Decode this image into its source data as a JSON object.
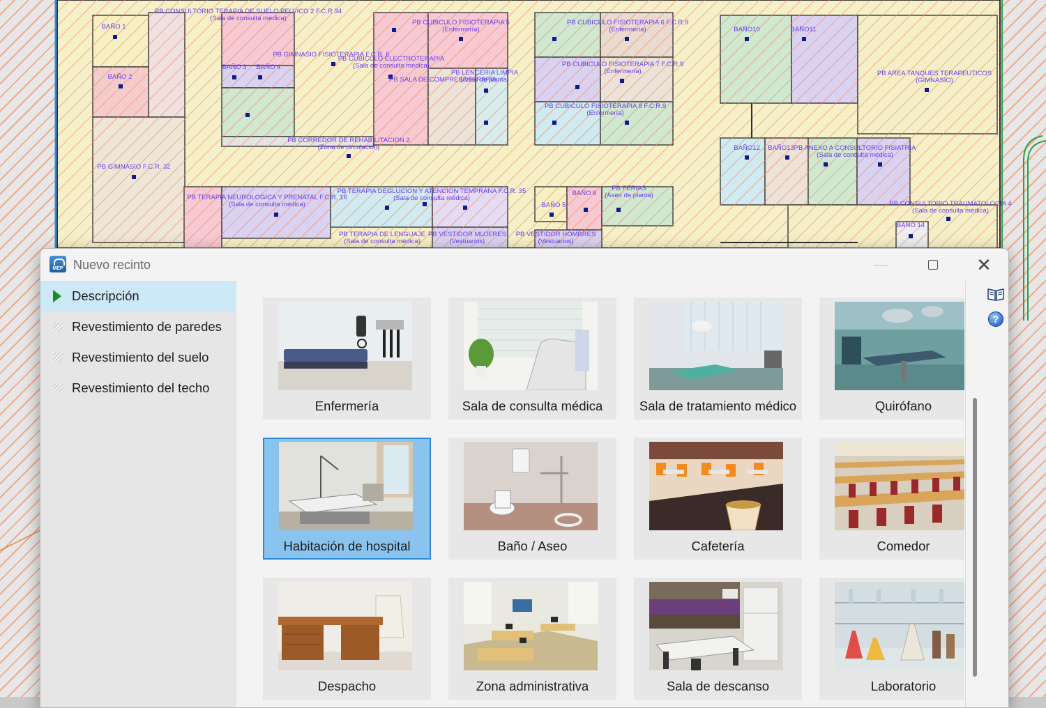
{
  "dialog": {
    "title": "Nuevo recinto",
    "app_icon_text": "MEP",
    "icons": {
      "app": "mep-app-icon",
      "minimize": "minimize-icon",
      "maximize": "maximize-icon",
      "close": "close-icon",
      "book": "book-icon",
      "help": "help-icon"
    }
  },
  "nav": {
    "items": [
      {
        "label": "Descripción",
        "active": true
      },
      {
        "label": "Revestimiento de paredes",
        "active": false
      },
      {
        "label": "Revestimiento del suelo",
        "active": false
      },
      {
        "label": "Revestimiento del techo",
        "active": false
      }
    ]
  },
  "rooms": [
    {
      "label": "Enfermería",
      "selected": false
    },
    {
      "label": "Sala de consulta médica",
      "selected": false
    },
    {
      "label": "Sala de tratamiento médico",
      "selected": false
    },
    {
      "label": "Quirófano",
      "selected": false
    },
    {
      "label": "Habitación de hospital",
      "selected": true
    },
    {
      "label": "Baño / Aseo",
      "selected": false
    },
    {
      "label": "Cafetería",
      "selected": false
    },
    {
      "label": "Comedor",
      "selected": false
    },
    {
      "label": "Despacho",
      "selected": false
    },
    {
      "label": "Zona administrativa",
      "selected": false
    },
    {
      "label": "Sala de descanso",
      "selected": false
    },
    {
      "label": "Laboratorio",
      "selected": false
    }
  ],
  "cad": {
    "labels": [
      {
        "name": "PB CONSULTORIO TERAPIA DE SUELO PELVICO 2 F.C.R 34",
        "sub": "(Sala de consulta médica)"
      },
      {
        "name": "BAÑO 1",
        "sub": ""
      },
      {
        "name": "BAÑO 2",
        "sub": ""
      },
      {
        "name": "PB GIMNASIO F.C.R. 32",
        "sub": ""
      },
      {
        "name": "PB GIMNASIO FISIOTERAPIA F.C.R. 6",
        "sub": ""
      },
      {
        "name": "BAÑO 3",
        "sub": ""
      },
      {
        "name": "BAÑO 4",
        "sub": ""
      },
      {
        "name": "PB CUBICULO ELECTROTERAPIA",
        "sub": "(Sala de consulta médica)"
      },
      {
        "name": "PB SALA DE COMPRESOTERAPIA",
        "sub": ""
      },
      {
        "name": "PB CORREDOR DE REHABILITACION 2",
        "sub": "(Zona de circulación)"
      },
      {
        "name": "PB LENCERIA LIMPIA",
        "sub": "(Aseo de planta)"
      },
      {
        "name": "PB CUBICULO FISIOTERAPIA 5",
        "sub": "(Enfermería)"
      },
      {
        "name": "PB CUBICULO FISIOTERAPIA 6 F.C.R.9",
        "sub": "(Enfermería)"
      },
      {
        "name": "PB CUBICULO FISIOTERAPIA 7 F.C.R.9",
        "sub": "(Enfermería)"
      },
      {
        "name": "PB CUBICULO FISIOTERAPIA 8 F.C.R.9",
        "sub": "(Enfermería)"
      },
      {
        "name": "BAÑO10",
        "sub": ""
      },
      {
        "name": "BAÑO11",
        "sub": ""
      },
      {
        "name": "PB AREA TANQUES TERAPEUTICOS",
        "sub": "(GIMNASIO)"
      },
      {
        "name": "BAÑO12",
        "sub": ""
      },
      {
        "name": "BAÑO13",
        "sub": ""
      },
      {
        "name": "PB ANEXO A CONSULTORIO FISIATRIA",
        "sub": "(Sala de consulta médica)"
      },
      {
        "name": "PB TERAPIA NEUROLOGICA Y PRENATAL F.C.R. 16",
        "sub": "(Sala de consulta médica)"
      },
      {
        "name": "PB TERAPIA DEGLUCION Y ATENCION TEMPRANA F.C.R. 35",
        "sub": "(Sala de consulta médica)"
      },
      {
        "name": "BAÑO 5",
        "sub": ""
      },
      {
        "name": "BAÑO 6",
        "sub": ""
      },
      {
        "name": "PB FERIAS",
        "sub": "(Aseo de planta)"
      },
      {
        "name": "PB TERAPIA DE LENGUAJE",
        "sub": "(Sala de consulta médica)"
      },
      {
        "name": "PB VESTIDOR MUJERES",
        "sub": "(Vestuarios)"
      },
      {
        "name": "PB VESTIDOR HOMBRES",
        "sub": "(Vestuarios)"
      },
      {
        "name": "PB CONSULTORIO TRAUMATOLOGIA 4",
        "sub": "(Sala de consulta médica)"
      },
      {
        "name": "BAÑO 14",
        "sub": ""
      }
    ]
  }
}
